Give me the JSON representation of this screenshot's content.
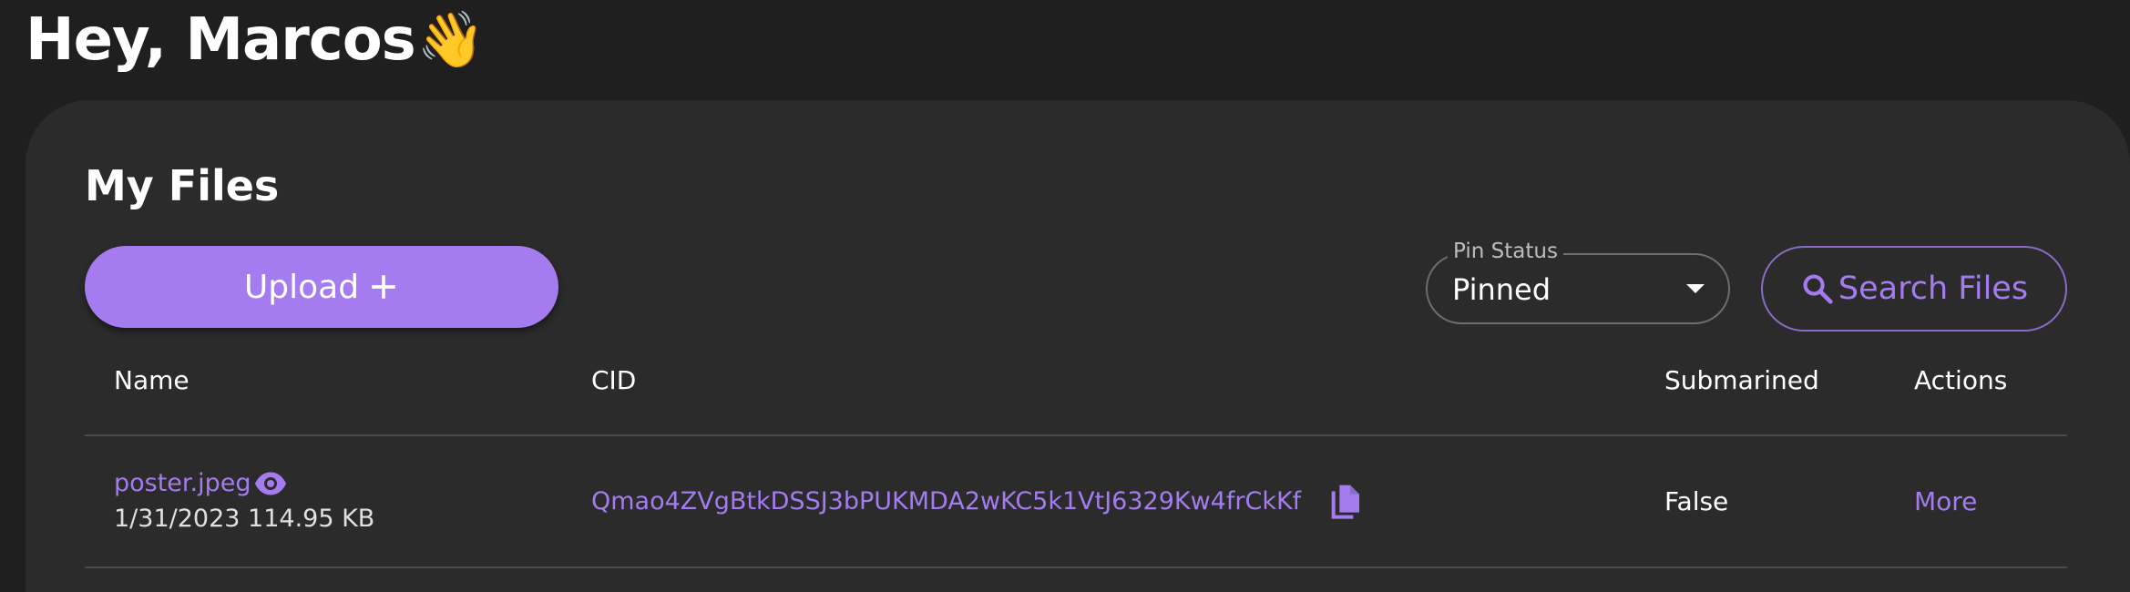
{
  "header": {
    "greeting": "Hey, Marcos",
    "wave_emoji": "👋"
  },
  "files_section": {
    "title": "My Files",
    "upload_label": "Upload",
    "pin_status": {
      "label": "Pin Status",
      "value": "Pinned"
    },
    "search_label": "Search Files"
  },
  "table": {
    "columns": [
      "Name",
      "CID",
      "Submarined",
      "Actions"
    ],
    "rows": [
      {
        "name": "poster.jpeg",
        "date": "1/31/2023",
        "size": "114.95 KB",
        "cid": "Qmao4ZVgBtkDSSJ3bPUKMDA2wKC5k1VtJ6329Kw4frCkKf",
        "submarined": "False",
        "action": "More"
      }
    ]
  },
  "colors": {
    "accent": "#a57bf0",
    "background": "#1f1f1f",
    "panel": "#2b2b2b"
  },
  "icons": {
    "upload": "plus-icon",
    "search": "search-icon",
    "preview": "eye-icon",
    "copy": "copy-icon",
    "dropdown": "caret-down-icon"
  }
}
